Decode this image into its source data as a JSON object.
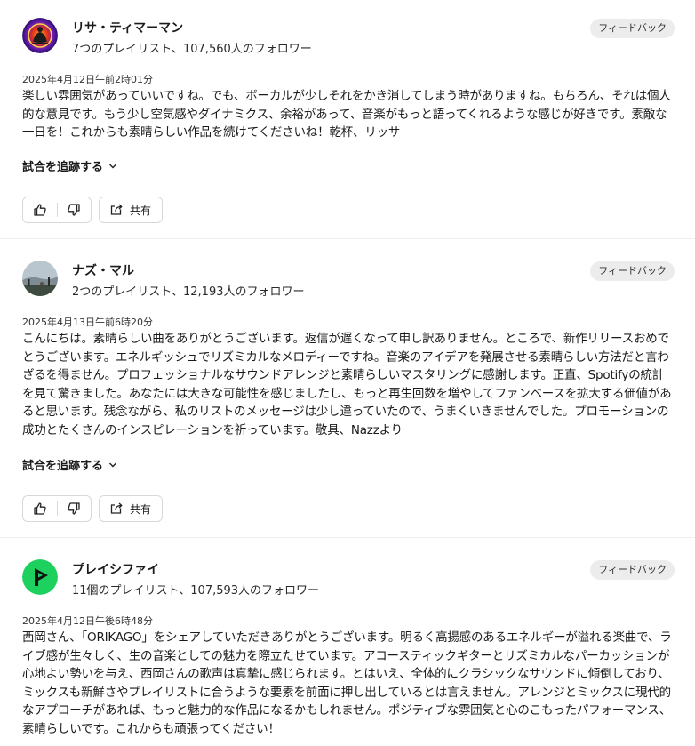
{
  "feedback_label": "フィードバック",
  "follow_label": "試合を追跡する",
  "share_label": "共有",
  "reviews": [
    {
      "name": "リサ・ティマーマン",
      "meta": "7つのプレイリスト、107,560人のフォロワー",
      "date": "2025年4月12日午前2時01分",
      "text": "楽しい雰囲気があっていいですね。でも、ボーカルが少しそれをかき消してしまう時がありますね。もちろん、それは個人的な意見です。もう少し空気感やダイナミクス、余裕があって、音楽がもっと語ってくれるような感じが好きです。素敵な一日を！これからも素晴らしい作品を続けてくださいね！乾杯、リッサ"
    },
    {
      "name": "ナズ・マル",
      "meta": "2つのプレイリスト、12,193人のフォロワー",
      "date": "2025年4月13日午前6時20分",
      "text": "こんにちは。素晴らしい曲をありがとうございます。返信が遅くなって申し訳ありません。ところで、新作リリースおめでとうございます。エネルギッシュでリズミカルなメロディーですね。音楽のアイデアを発展させる素晴らしい方法だと言わざるを得ません。プロフェッショナルなサウンドアレンジと素晴らしいマスタリングに感謝します。正直、Spotifyの統計を見て驚きました。あなたには大きな可能性を感じましたし、もっと再生回数を増やしてファンベースを拡大する価値があると思います。残念ながら、私のリストのメッセージは少し違っていたので、うまくいきませんでした。プロモーションの成功とたくさんのインスピレーションを祈っています。敬具、Nazzより"
    },
    {
      "name": "プレイシファイ",
      "meta": "11個のプレイリスト、107,593人のフォロワー",
      "date": "2025年4月12日午後6時48分",
      "text": "西岡さん、「ORIKAGO」をシェアしていただきありがとうございます。明るく高揚感のあるエネルギーが溢れる楽曲で、ライブ感が生々しく、生の音楽としての魅力を際立たせています。アコースティックギターとリズミカルなパーカッションが心地よい勢いを与え、西岡さんの歌声は真摯に感じられます。とはいえ、全体的にクラシックなサウンドに傾倒しており、ミックスも新鮮さやプレイリストに合うような要素を前面に押し出しているとは言えません。アレンジとミックスに現代的なアプローチがあれば、もっと魅力的な作品になるかもしれません。ポジティブな雰囲気と心のこもったパフォーマンス、素晴らしいです。これからも頑張ってください！"
    }
  ]
}
